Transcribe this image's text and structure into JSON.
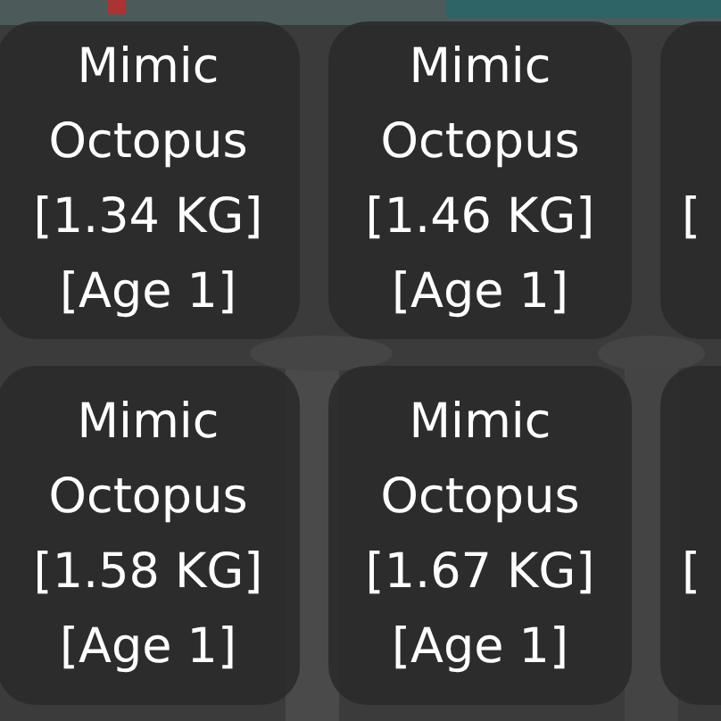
{
  "inventory": {
    "items": [
      {
        "kind": "full",
        "name": "Mimic Octopus",
        "weight": "[1.34 KG]",
        "age": "[Age 1]"
      },
      {
        "kind": "full",
        "name": "Mimic Octopus",
        "weight": "[1.46 KG]",
        "age": "[Age 1]"
      },
      {
        "kind": "partial",
        "text": "["
      },
      {
        "kind": "full",
        "name": "Mimic Octopus",
        "weight": "[1.58 KG]",
        "age": "[Age 1]"
      },
      {
        "kind": "full",
        "name": "Mimic Octopus",
        "weight": "[1.67 KG]",
        "age": "[Age 1]"
      },
      {
        "kind": "partial",
        "text": "["
      }
    ]
  }
}
